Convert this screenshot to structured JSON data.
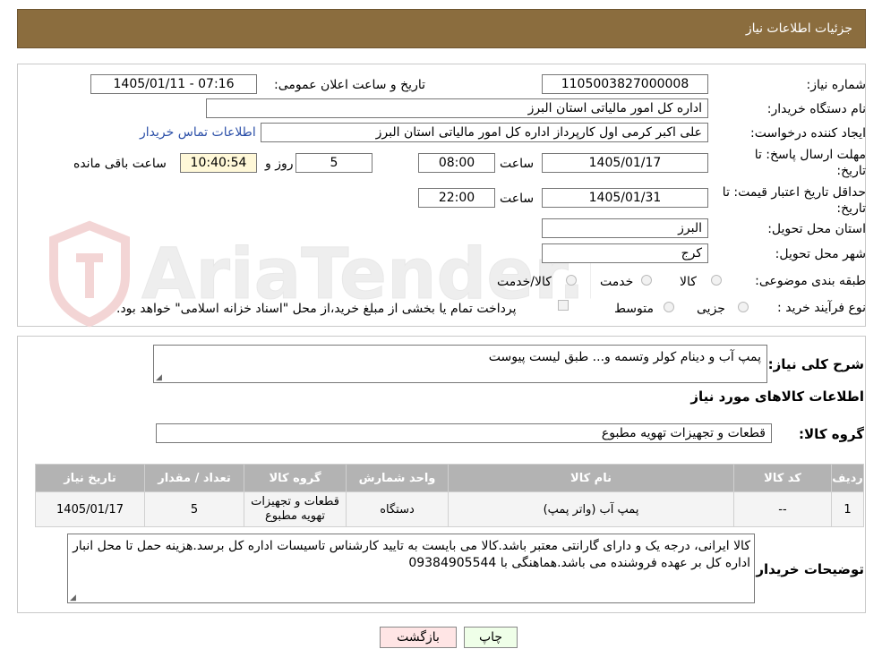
{
  "header": {
    "title": "جزئیات اطلاعات نیاز"
  },
  "details": {
    "need_number_label": "شماره نیاز:",
    "need_number": "1105003827000008",
    "announce_label": "تاریخ و ساعت اعلان عمومی:",
    "announce_value": "1405/01/11 - 07:16",
    "buyer_org_label": "نام دستگاه خریدار:",
    "buyer_org": "اداره کل امور مالیاتی استان البرز",
    "creator_label": "ایجاد کننده درخواست:",
    "creator": "علی اکبر کرمی اول کارپرداز اداره کل امور مالیاتی استان البرز",
    "contact_link": "اطلاعات تماس خریدار",
    "deadline_label": "مهلت ارسال پاسخ: تا تاریخ:",
    "deadline_date": "1405/01/17",
    "time_label": "ساعت",
    "deadline_time": "08:00",
    "days_value": "5",
    "days_label": "روز و",
    "remaining_time": "10:40:54",
    "remaining_label": "ساعت باقی مانده",
    "validity_label": "حداقل تاریخ اعتبار قیمت: تا تاریخ:",
    "validity_date": "1405/01/31",
    "validity_time": "22:00",
    "province_label": "استان محل تحویل:",
    "province": "البرز",
    "city_label": "شهر محل تحویل:",
    "city": "کرج",
    "category_label": "طبقه بندی موضوعی:",
    "category_options": [
      "کالا",
      "خدمت",
      "کالا/خدمت"
    ],
    "process_label": "نوع فرآیند خرید :",
    "process_options": [
      "جزیی",
      "متوسط"
    ],
    "payment_note": "پرداخت تمام یا بخشی از مبلغ خرید،از محل \"اسناد خزانه اسلامی\" خواهد بود."
  },
  "summary": {
    "desc_label": "شرح کلی نیاز:",
    "desc_value": "پمپ آب و دینام کولر وتسمه و... طبق لیست پیوست",
    "goods_info_title": "اطلاعات کالاهای مورد نیاز",
    "goods_group_label": "گروه کالا:",
    "goods_group_value": "قطعات و تجهیزات تهویه مطبوع"
  },
  "table": {
    "headers": [
      "ردیف",
      "کد کالا",
      "نام کالا",
      "واحد شمارش",
      "گروه کالا",
      "تعداد / مقدار",
      "تاریخ نیاز"
    ],
    "rows": [
      [
        "1",
        "--",
        "پمپ آب (واتر پمپ)",
        "دستگاه",
        "قطعات و تجهیزات تهویه مطبوع",
        "5",
        "1405/01/17"
      ]
    ]
  },
  "buyer_notes": {
    "label": "توضیحات خریدار:",
    "value": "کالا  ایرانی، درجه یک و دارای گارانتی معتبر باشد.کالا می بایست به تایید کارشناس تاسیسات اداره کل برسد.هزینه حمل تا محل انبار اداره کل بر عهده فروشنده می باشد.هماهنگی با 09384905544"
  },
  "buttons": {
    "print": "چاپ",
    "back": "بازگشت"
  },
  "watermark": {
    "text": "AriaTender.neT"
  },
  "colors": {
    "header_bg": "#8b6d3e",
    "table_header": "#b3b3b3",
    "print_btn": "#efffe8",
    "back_btn": "#ffe5e5",
    "link": "#2b4fa8"
  }
}
